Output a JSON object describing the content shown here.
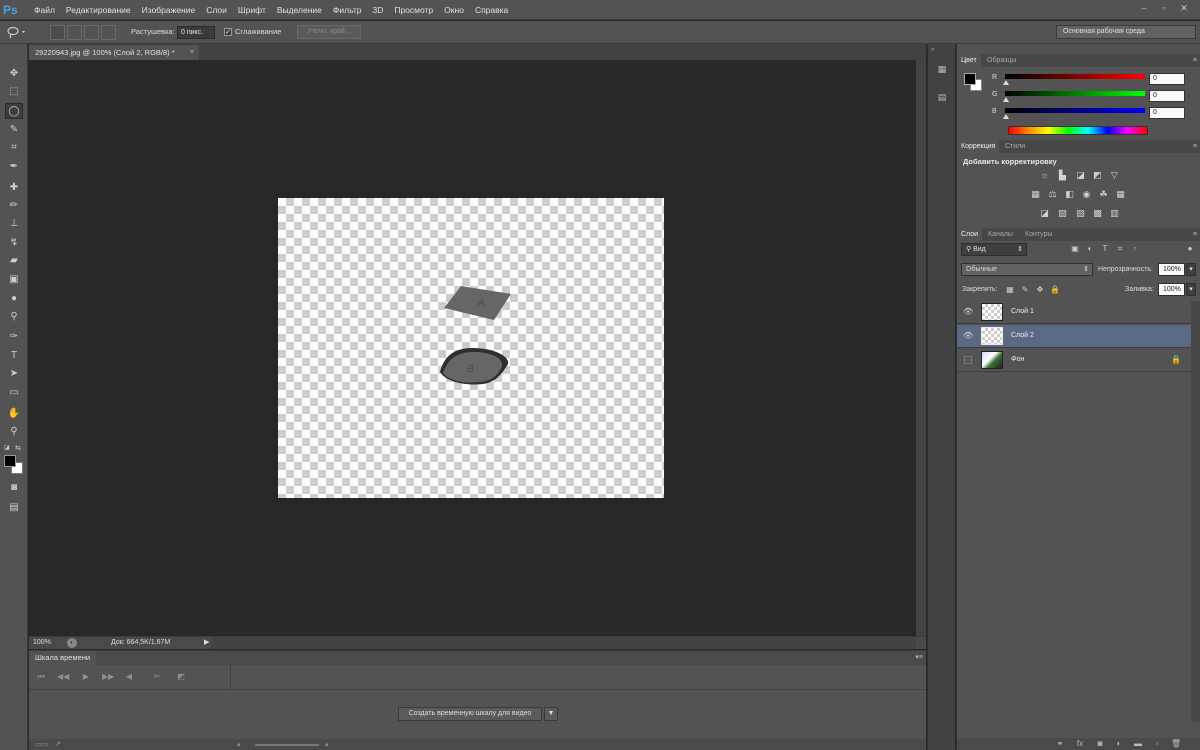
{
  "app": {
    "logo": "Ps"
  },
  "menu": [
    "Файл",
    "Редактирование",
    "Изображение",
    "Слои",
    "Шрифт",
    "Выделение",
    "Фильтр",
    "3D",
    "Просмотр",
    "Окно",
    "Справка"
  ],
  "window_controls": {
    "minimize": "–",
    "restore": "▫",
    "close": "✕"
  },
  "options": {
    "feather_label": "Растушевка:",
    "feather_value": "0 пикс.",
    "antialias_checked": true,
    "antialias_check_glyph": "✓",
    "antialias_label": "Сглаживание",
    "refine_edge_label": "Уточн. край...",
    "workspace": "Основная рабочая среда"
  },
  "document": {
    "tab_title": "29220943.jpg @ 100% (Слой 2, RGB/8) *",
    "close_glyph": "×"
  },
  "status": {
    "zoom": "100%",
    "doc_size": "Док: 664,5K/1,67M",
    "arrow": "▶"
  },
  "canvas_shapes": [
    {
      "label": "A"
    },
    {
      "label": "B"
    }
  ],
  "timeline": {
    "tab_label": "Шкала времени",
    "menu_glyph": "▾≡",
    "create_button": "Создать временную шкалу для видео",
    "dropdown_glyph": "▼"
  },
  "color_panel": {
    "tabs": [
      "Цвет",
      "Образцы"
    ],
    "channels": [
      {
        "label": "R",
        "value": "0"
      },
      {
        "label": "G",
        "value": "0"
      },
      {
        "label": "B",
        "value": "0"
      }
    ],
    "colors": {
      "foreground": "#000000",
      "background": "#ffffff"
    }
  },
  "adjustments_panel": {
    "tabs": [
      "Коррекция",
      "Стили"
    ],
    "title": "Добавить корректировку"
  },
  "layers_panel": {
    "tabs": [
      "Слои",
      "Каналы",
      "Контуры"
    ],
    "filter_kind": "Вид",
    "blend_mode": "Обычные",
    "opacity_label": "Непрозрачность:",
    "opacity_value": "100%",
    "lock_label": "Закрепить:",
    "fill_label": "Заливка:",
    "fill_value": "100%",
    "layers": [
      {
        "name": "Слой 1",
        "visible": true,
        "selected": false,
        "locked": false
      },
      {
        "name": "Слой 2",
        "visible": true,
        "selected": true,
        "locked": false
      },
      {
        "name": "Фон",
        "visible": false,
        "selected": false,
        "locked": true
      }
    ]
  },
  "colors": {
    "accent_selected_layer": "#5b6a84",
    "panel_bg": "#535353",
    "canvas_bg": "#282828"
  }
}
